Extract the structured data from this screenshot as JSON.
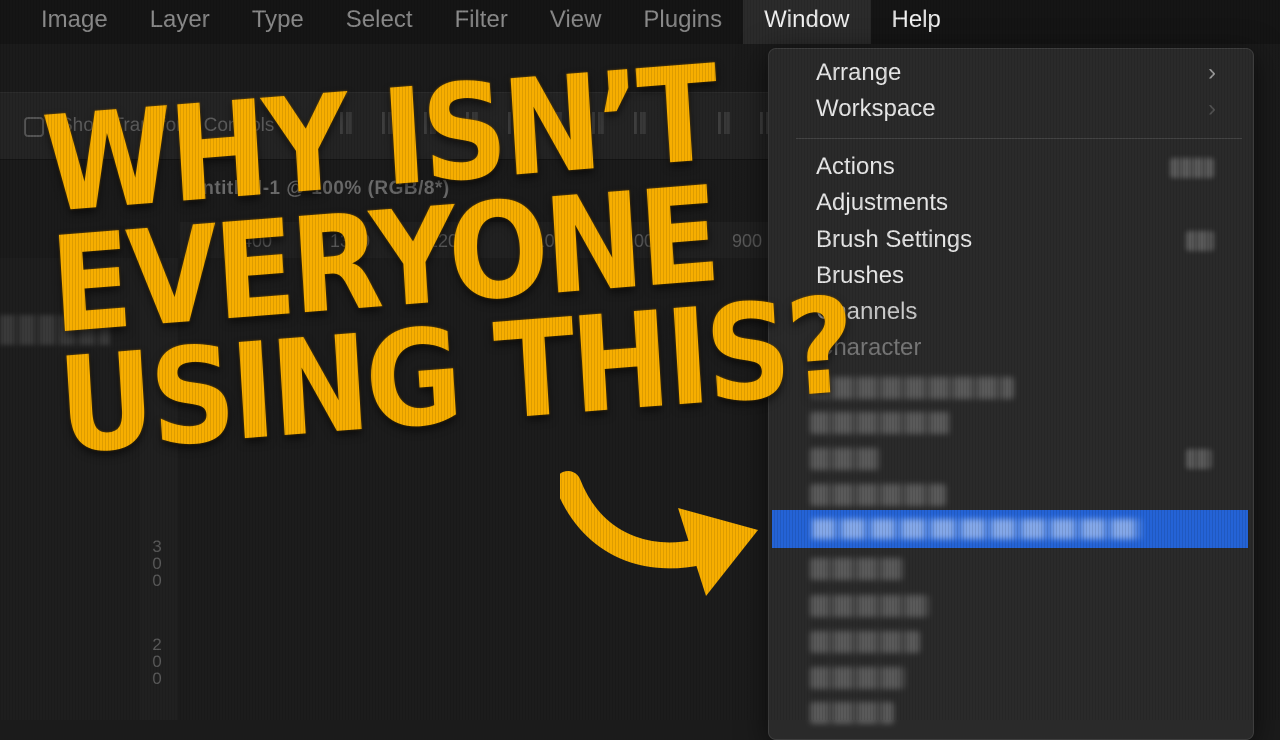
{
  "menubar": {
    "items": [
      "Image",
      "Layer",
      "Type",
      "Select",
      "Filter",
      "View",
      "Plugins",
      "Window",
      "Help"
    ]
  },
  "options_bar": {
    "show_transform_label": "Show Transform Controls"
  },
  "document": {
    "tab_title": "Untitled-1 @ 100% (RGB/8*)",
    "ruler_h": [
      "1400",
      "1300",
      "1200",
      "1100",
      "1000",
      "900"
    ],
    "ruler_v": [
      "300",
      "200"
    ]
  },
  "window_menu": {
    "group1": [
      "Arrange",
      "Workspace"
    ],
    "group2": [
      "Actions",
      "Adjustments",
      "Brush Settings",
      "Brushes",
      "Channels",
      "Character"
    ]
  },
  "headline": {
    "line1": "WHY ISN’T",
    "line2": "EVERYONE",
    "line3": "USING THIS?"
  },
  "colors": {
    "headline": "#f7ae00",
    "highlight": "#2463d6"
  }
}
